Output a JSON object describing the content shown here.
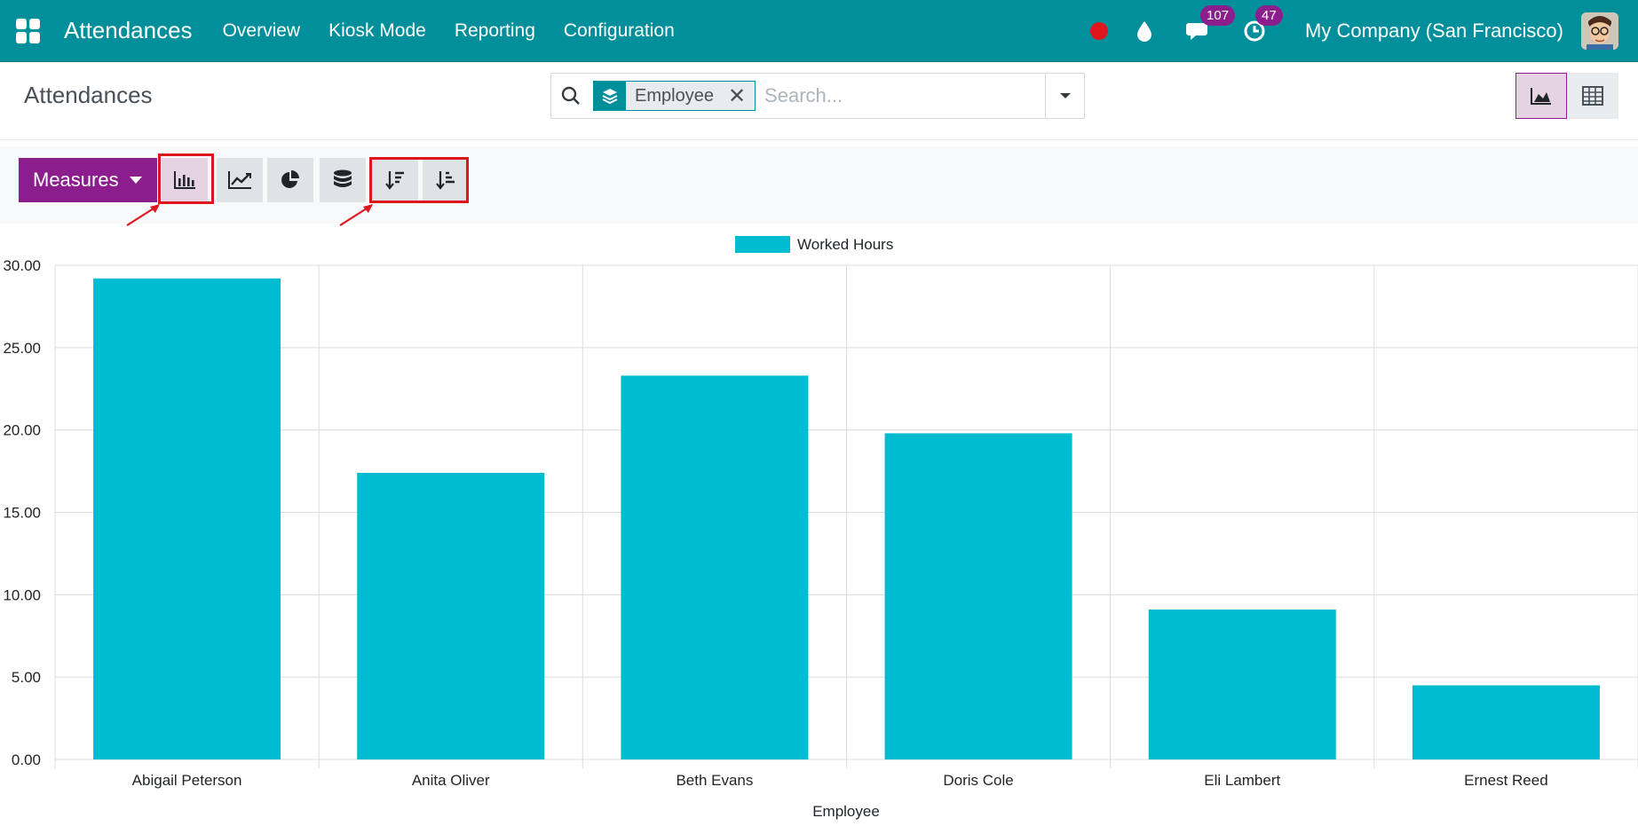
{
  "navbar": {
    "app_title": "Attendances",
    "menu": [
      "Overview",
      "Kiosk Mode",
      "Reporting",
      "Configuration"
    ],
    "messages_count": "107",
    "activities_count": "47",
    "company": "My Company (San Francisco)"
  },
  "control": {
    "page_title": "Attendances",
    "facet_value": "Employee",
    "search_placeholder": "Search..."
  },
  "toolbar": {
    "measures_label": "Measures"
  },
  "colors": {
    "navbar": "#018f9b",
    "primary": "#8c1d8c",
    "bar": "#00bcd0",
    "highlight": "#e0161e"
  },
  "chart_data": {
    "type": "bar",
    "categories": [
      "Abigail Peterson",
      "Anita Oliver",
      "Beth Evans",
      "Doris Cole",
      "Eli Lambert",
      "Ernest Reed"
    ],
    "series": [
      {
        "name": "Worked Hours",
        "values": [
          29.2,
          17.4,
          23.3,
          19.8,
          9.1,
          4.5
        ]
      }
    ],
    "title": "",
    "xlabel": "Employee",
    "ylabel": "",
    "ylim": [
      0,
      30
    ],
    "yticks": [
      "0.00",
      "5.00",
      "10.00",
      "15.00",
      "20.00",
      "25.00",
      "30.00"
    ],
    "grid": true,
    "legend": "top-center"
  }
}
